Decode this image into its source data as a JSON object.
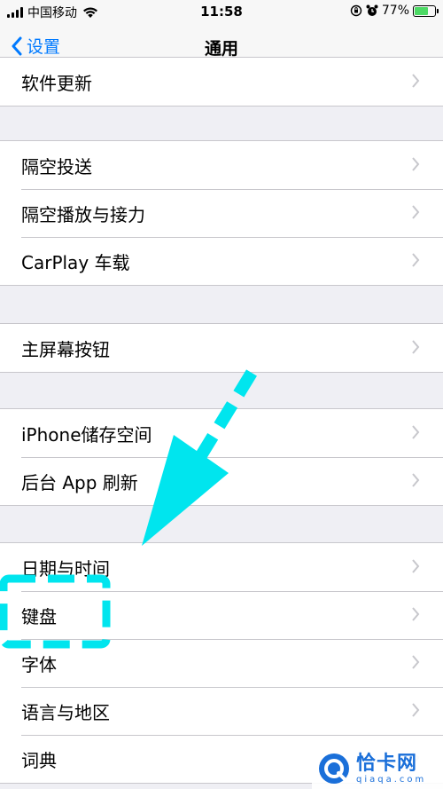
{
  "status_bar": {
    "carrier": "中国移动",
    "time": "11:58",
    "battery_percent": "77%",
    "battery_level": 0.77,
    "icons": [
      "signal-icon",
      "wifi-icon",
      "orientation-lock-icon",
      "alarm-icon",
      "battery-icon"
    ]
  },
  "nav": {
    "back_label": "设置",
    "title": "通用"
  },
  "groups": [
    {
      "items": [
        "软件更新"
      ]
    },
    {
      "items": [
        "隔空投送",
        "隔空播放与接力",
        "CarPlay 车载"
      ]
    },
    {
      "items": [
        "主屏幕按钮"
      ]
    },
    {
      "items": [
        "iPhone储存空间",
        "后台 App 刷新"
      ]
    },
    {
      "items": [
        "日期与时间",
        "键盘",
        "字体",
        "语言与地区",
        "词典"
      ]
    }
  ],
  "colors": {
    "accent": "#007aff",
    "annotation": "#00e5ee",
    "battery": "#4cd964"
  },
  "watermark": {
    "name": "恰卡网",
    "domain": "qiaqa.com"
  }
}
